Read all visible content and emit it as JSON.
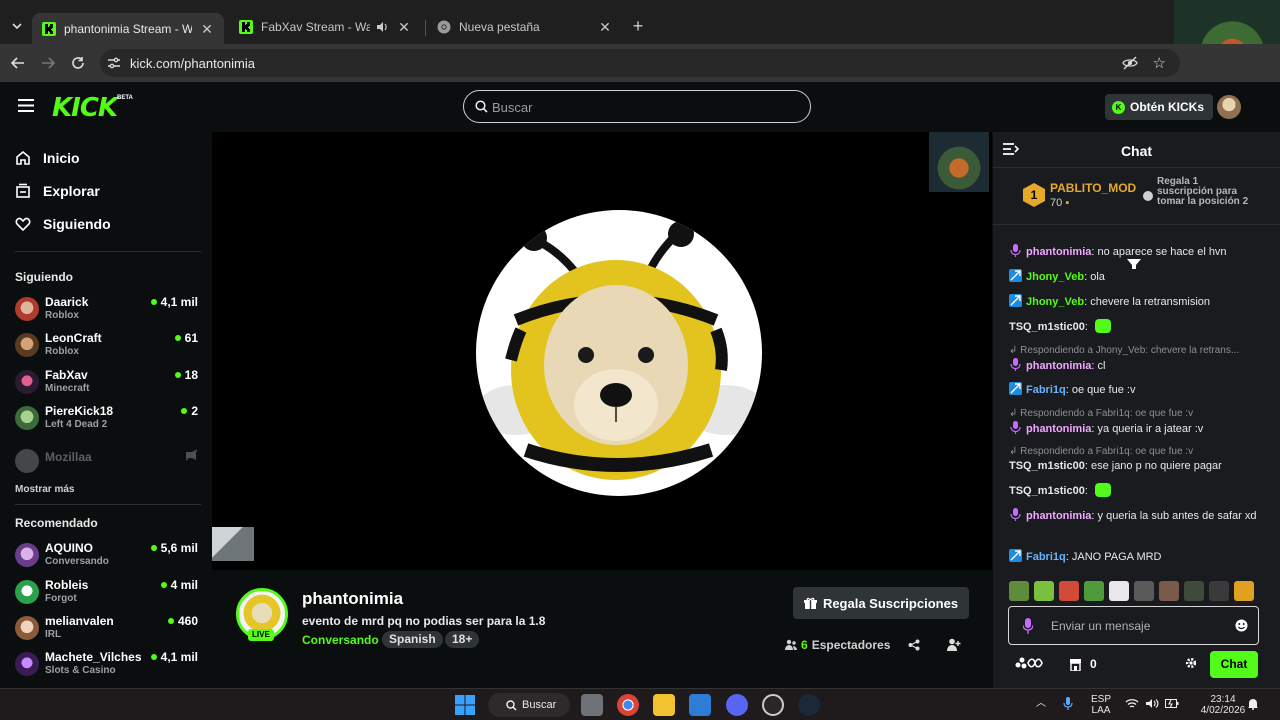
{
  "browser": {
    "tabs": [
      {
        "title": "phantonimia Stream - Watch Live",
        "active": true,
        "favicon": "kick-icon"
      },
      {
        "title": "FabXav Stream - Watch Live",
        "active": false,
        "favicon": "kick-icon",
        "audio": true
      },
      {
        "title": "Nueva pestaña",
        "active": false,
        "favicon": "chrome-icon"
      }
    ],
    "url": "kick.com/phantonimia"
  },
  "header": {
    "logo": "KICK",
    "beta": "BETA",
    "search_placeholder": "Buscar",
    "get_kicks": "Obtén KICKs"
  },
  "sidebar": {
    "nav": [
      {
        "label": "Inicio",
        "icon": "home-icon"
      },
      {
        "label": "Explorar",
        "icon": "browse-icon"
      },
      {
        "label": "Siguiendo",
        "icon": "heart-icon"
      }
    ],
    "following_title": "Siguiendo",
    "following": [
      {
        "name": "Daarick",
        "category": "Roblox",
        "viewers": "4,1 mil"
      },
      {
        "name": "LeonCraft",
        "category": "Roblox",
        "viewers": "61"
      },
      {
        "name": "FabXav",
        "category": "Minecraft",
        "viewers": "18"
      },
      {
        "name": "PiereKick18",
        "category": "Left 4 Dead 2",
        "viewers": "2"
      },
      {
        "name": "Mozillaa",
        "category": "",
        "viewers": ""
      }
    ],
    "show_more": "Mostrar más",
    "recommended_title": "Recomendado",
    "recommended": [
      {
        "name": "AQUINO",
        "category": "Conversando",
        "viewers": "5,6 mil"
      },
      {
        "name": "Robleis",
        "category": "Forgot",
        "viewers": "4 mil"
      },
      {
        "name": "melianvalen",
        "category": "IRL",
        "viewers": "460"
      },
      {
        "name": "Machete_Vilches",
        "category": "Slots & Casino",
        "viewers": "4,1 mil"
      }
    ]
  },
  "stream": {
    "live_badge": "LIVE",
    "channel": "phantonimia",
    "title": "evento de mrd pq no podias ser para la 1.8",
    "category": "Conversando",
    "tags": [
      "Spanish",
      "18+"
    ],
    "gift_button": "Regala Suscripciones",
    "viewer_count": "6",
    "viewer_label": "Espectadores"
  },
  "chat": {
    "title": "Chat",
    "pinned": {
      "rank": "1",
      "user": "PABLITO_MOD",
      "points": "70",
      "promo": "Regala 1 suscripción para tomar la posición 2"
    },
    "messages": [
      {
        "user": "phantonimia",
        "text": "no aparece se hace el hvn",
        "color": "#f3a6ff",
        "badge": "mic"
      },
      {
        "user": "Jhony_Veb",
        "text": "ola",
        "color": "#53fc18",
        "badge": "star"
      },
      {
        "user": "Jhony_Veb",
        "text": "chevere la retransmision",
        "color": "#53fc18",
        "badge": "star"
      },
      {
        "user": "TSQ_m1stic00",
        "text": "",
        "color": "#ffffff",
        "emote": true
      },
      {
        "reply": "Respondiendo a Jhony_Veb: chevere la retrans..."
      },
      {
        "user": "phantonimia",
        "text": "cl",
        "color": "#f3a6ff",
        "badge": "mic"
      },
      {
        "user": "Fabri1q",
        "text": "oe que fue :v",
        "color": "#6ab3ff",
        "badge": "star"
      },
      {
        "reply": "Respondiendo a Fabri1q: oe que fue :v"
      },
      {
        "user": "phantonimia",
        "text": "ya queria ir a jatear :v",
        "color": "#f3a6ff",
        "badge": "mic"
      },
      {
        "reply": "Respondiendo a Fabri1q: oe que fue :v"
      },
      {
        "user": "TSQ_m1stic00",
        "text": "ese jano p no quiere pagar",
        "color": "#ffffff"
      },
      {
        "user": "TSQ_m1stic00",
        "text": "",
        "color": "#ffffff",
        "emote": true
      },
      {
        "user": "phantonimia",
        "text": "y queria la sub antes de safar xd",
        "color": "#f3a6ff",
        "badge": "mic"
      },
      {
        "user": "Fabri1q",
        "text": "JANO PAGA MRD",
        "color": "#6ab3ff",
        "badge": "star"
      }
    ],
    "input_placeholder": "Enviar un mensaje",
    "points": "0",
    "send_label": "Chat"
  },
  "taskbar": {
    "search": "Buscar",
    "lang_top": "ESP",
    "lang_bottom": "LAA",
    "time": "23:14",
    "date": "4/02/2026"
  },
  "colors": {
    "brand": "#53fc18",
    "bg": "#0b0e0f",
    "chat_bg": "#191b1f",
    "pinned_gold": "#e5a92c"
  }
}
